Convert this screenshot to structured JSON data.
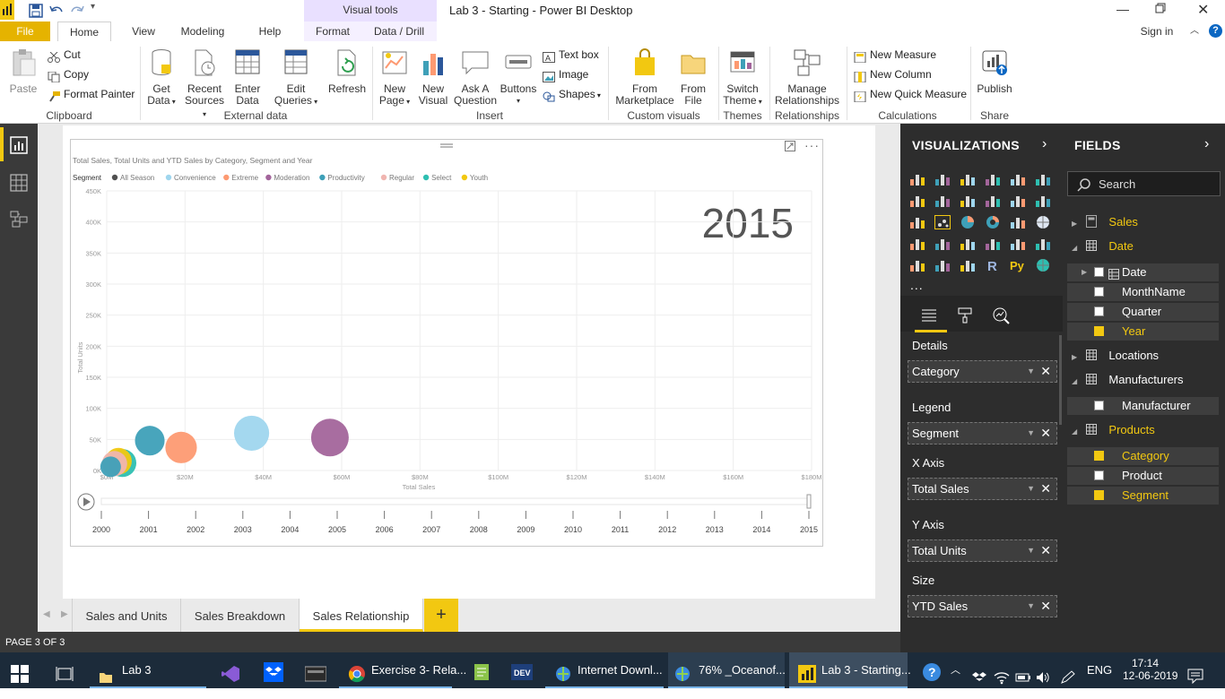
{
  "titlebar": {
    "visual_tools": "Visual tools",
    "title": "Lab 3 - Starting - Power BI Desktop"
  },
  "tabs": {
    "file": "File",
    "home": "Home",
    "view": "View",
    "modeling": "Modeling",
    "help": "Help",
    "format": "Format",
    "data_drill": "Data / Drill",
    "sign_in": "Sign in"
  },
  "ribbon": {
    "paste": "Paste",
    "cut": "Cut",
    "copy": "Copy",
    "format_painter": "Format Painter",
    "clipboard": "Clipboard",
    "get_data": [
      "Get",
      "Data"
    ],
    "recent_sources": [
      "Recent",
      "Sources"
    ],
    "enter_data": [
      "Enter",
      "Data"
    ],
    "edit_queries": [
      "Edit",
      "Queries"
    ],
    "refresh": "Refresh",
    "external_data": "External data",
    "new_page": [
      "New",
      "Page"
    ],
    "new_visual": [
      "New",
      "Visual"
    ],
    "ask_question": [
      "Ask A",
      "Question"
    ],
    "buttons": "Buttons",
    "text_box": "Text box",
    "image": "Image",
    "shapes": "Shapes",
    "insert": "Insert",
    "from_marketplace": [
      "From",
      "Marketplace"
    ],
    "from_file": [
      "From",
      "File"
    ],
    "custom_visuals": "Custom visuals",
    "switch_theme": [
      "Switch",
      "Theme"
    ],
    "themes": "Themes",
    "manage_relationships": [
      "Manage",
      "Relationships"
    ],
    "relationships": "Relationships",
    "new_measure": "New Measure",
    "new_column": "New Column",
    "new_quick_measure": "New Quick Measure",
    "calculations": "Calculations",
    "publish": "Publish",
    "share": "Share"
  },
  "chart_data": {
    "type": "scatter",
    "title": "Total Sales, Total Units and YTD Sales by Category, Segment and Year",
    "legend_title": "Segment",
    "legend": [
      {
        "name": "All Season",
        "color": "#505050"
      },
      {
        "name": "Convenience",
        "color": "#9fd6ee"
      },
      {
        "name": "Extreme",
        "color": "#fd9a72"
      },
      {
        "name": "Moderation",
        "color": "#a3659b"
      },
      {
        "name": "Productivity",
        "color": "#3ea0b8"
      },
      {
        "name": "Regular",
        "color": "#f0b5b0"
      },
      {
        "name": "Select",
        "color": "#2ebfb1"
      },
      {
        "name": "Youth",
        "color": "#f2c811"
      }
    ],
    "legend_position": "top-left",
    "xlabel": "Total Sales",
    "ylabel": "Total Units",
    "x_ticks": [
      "$0M",
      "$20M",
      "$40M",
      "$60M",
      "$80M",
      "$100M",
      "$120M",
      "$140M",
      "$160M",
      "$180M"
    ],
    "y_ticks": [
      "0K",
      "50K",
      "100K",
      "150K",
      "200K",
      "250K",
      "300K",
      "350K",
      "400K",
      "450K"
    ],
    "xlim": [
      0,
      180
    ],
    "ylim": [
      0,
      450
    ],
    "play_axis_label": "2015",
    "years": [
      "2000",
      "2001",
      "2002",
      "2003",
      "2004",
      "2005",
      "2006",
      "2007",
      "2008",
      "2009",
      "2010",
      "2011",
      "2012",
      "2013",
      "2014",
      "2015"
    ],
    "points": [
      {
        "segment": "Moderation",
        "x": 57,
        "y": 53,
        "size": 1.0,
        "color": "#a3659b"
      },
      {
        "segment": "Convenience",
        "x": 37,
        "y": 60,
        "size": 0.87,
        "color": "#9fd6ee"
      },
      {
        "segment": "Extreme",
        "x": 19,
        "y": 37,
        "size": 0.7,
        "color": "#fd9a72"
      },
      {
        "segment": "Productivity",
        "x": 11,
        "y": 48,
        "size": 0.62,
        "color": "#3ea0b8"
      },
      {
        "segment": "Select",
        "x": 4,
        "y": 12,
        "size": 0.55,
        "color": "#2ebfb1"
      },
      {
        "segment": "Youth",
        "x": 3,
        "y": 15,
        "size": 0.5,
        "color": "#f2c811"
      },
      {
        "segment": "Regular",
        "x": 2,
        "y": 11,
        "size": 0.45,
        "color": "#f0b5b0"
      },
      {
        "segment": "All Season",
        "x": 1,
        "y": 6,
        "size": 0.3,
        "color": "#3ea0b8"
      }
    ],
    "grid": true
  },
  "page_tabs": [
    "Sales and Units",
    "Sales Breakdown",
    "Sales Relationship"
  ],
  "status": "PAGE 3 OF 3",
  "viz": {
    "header": "VISUALIZATIONS",
    "wells": [
      {
        "label": "Details",
        "value": "Category"
      },
      {
        "label": "Legend",
        "value": "Segment"
      },
      {
        "label": "X Axis",
        "value": "Total Sales"
      },
      {
        "label": "Y Axis",
        "value": "Total Units"
      },
      {
        "label": "Size",
        "value": "YTD Sales"
      }
    ],
    "more": "..."
  },
  "fields": {
    "header": "FIELDS",
    "search_placeholder": "Search",
    "tables": {
      "sales": "Sales",
      "date": "Date",
      "date_field": "Date",
      "monthname": "MonthName",
      "quarter": "Quarter",
      "year": "Year",
      "locations": "Locations",
      "manufacturers": "Manufacturers",
      "manufacturer": "Manufacturer",
      "products": "Products",
      "category": "Category",
      "product": "Product",
      "segment": "Segment"
    }
  },
  "taskbar": {
    "lab3": "Lab 3",
    "exercise": "Exercise 3- Rela...",
    "internet": "Internet Downl...",
    "ocean": "76% _Oceanof...",
    "powerbi": "Lab 3 - Starting...",
    "lang": "ENG",
    "time": "17:14",
    "date": "12-06-2019"
  }
}
